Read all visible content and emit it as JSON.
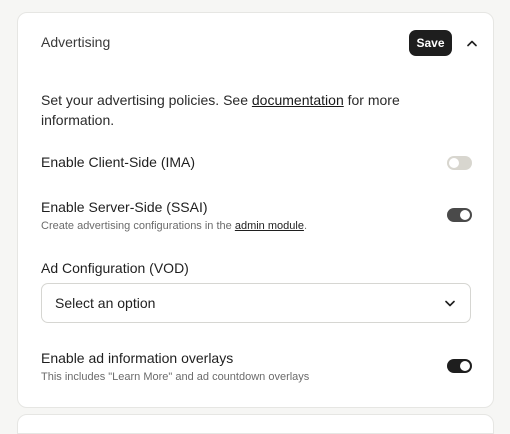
{
  "advertising": {
    "title": "Advertising",
    "save_label": "Save",
    "intro_prefix": "Set your advertising policies. See ",
    "intro_link": "documentation",
    "intro_suffix": " for more information.",
    "client_side": {
      "label": "Enable Client-Side (IMA)",
      "enabled": false
    },
    "server_side": {
      "label": "Enable Server-Side (SSAI)",
      "help_prefix": "Create advertising configurations in the ",
      "help_link": "admin module",
      "help_suffix": ".",
      "enabled": true
    },
    "ad_config": {
      "label": "Ad Configuration (VOD)",
      "selected": "Select an option"
    },
    "overlays": {
      "label": "Enable ad information overlays",
      "help": "This includes \"Learn More\" and ad countdown overlays",
      "enabled": true
    }
  },
  "icons": {
    "collapse": "chevron-up-icon",
    "dropdown": "chevron-down-icon"
  },
  "colors": {
    "primary_button": "#1e1e1e",
    "toggle_off": "#d8d6cf",
    "toggle_on": "#4a4a4a",
    "border": "#e6e6e3"
  }
}
